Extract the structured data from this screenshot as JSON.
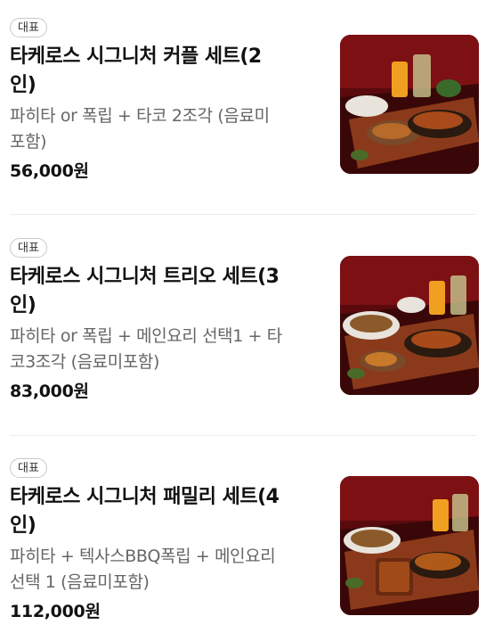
{
  "items": [
    {
      "badge": "대표",
      "name_line1": "타케로스 시그니처 커플 세트(2",
      "name_line2": "인)",
      "desc_line1": "파히타 or 폭립 + 타코 2조각 (음료미",
      "desc_line2": "포함)",
      "price": "56,000원",
      "image": "couple-set-photo"
    },
    {
      "badge": "대표",
      "name_line1": "타케로스 시그니처 트리오 세트(3",
      "name_line2": "인)",
      "desc_line1": "파히타 or 폭립 + 메인요리 선택1 + 타",
      "desc_line2": "코3조각 (음료미포함)",
      "price": "83,000원",
      "image": "trio-set-photo"
    },
    {
      "badge": "대표",
      "name_line1": "타케로스 시그니처 패밀리 세트(4",
      "name_line2": "인)",
      "desc_line1": "파히타 + 텍사스BBQ폭립 + 메인요리",
      "desc_line2": "선택 1 (음료미포함)",
      "price": "112,000원",
      "image": "family-set-photo"
    }
  ]
}
